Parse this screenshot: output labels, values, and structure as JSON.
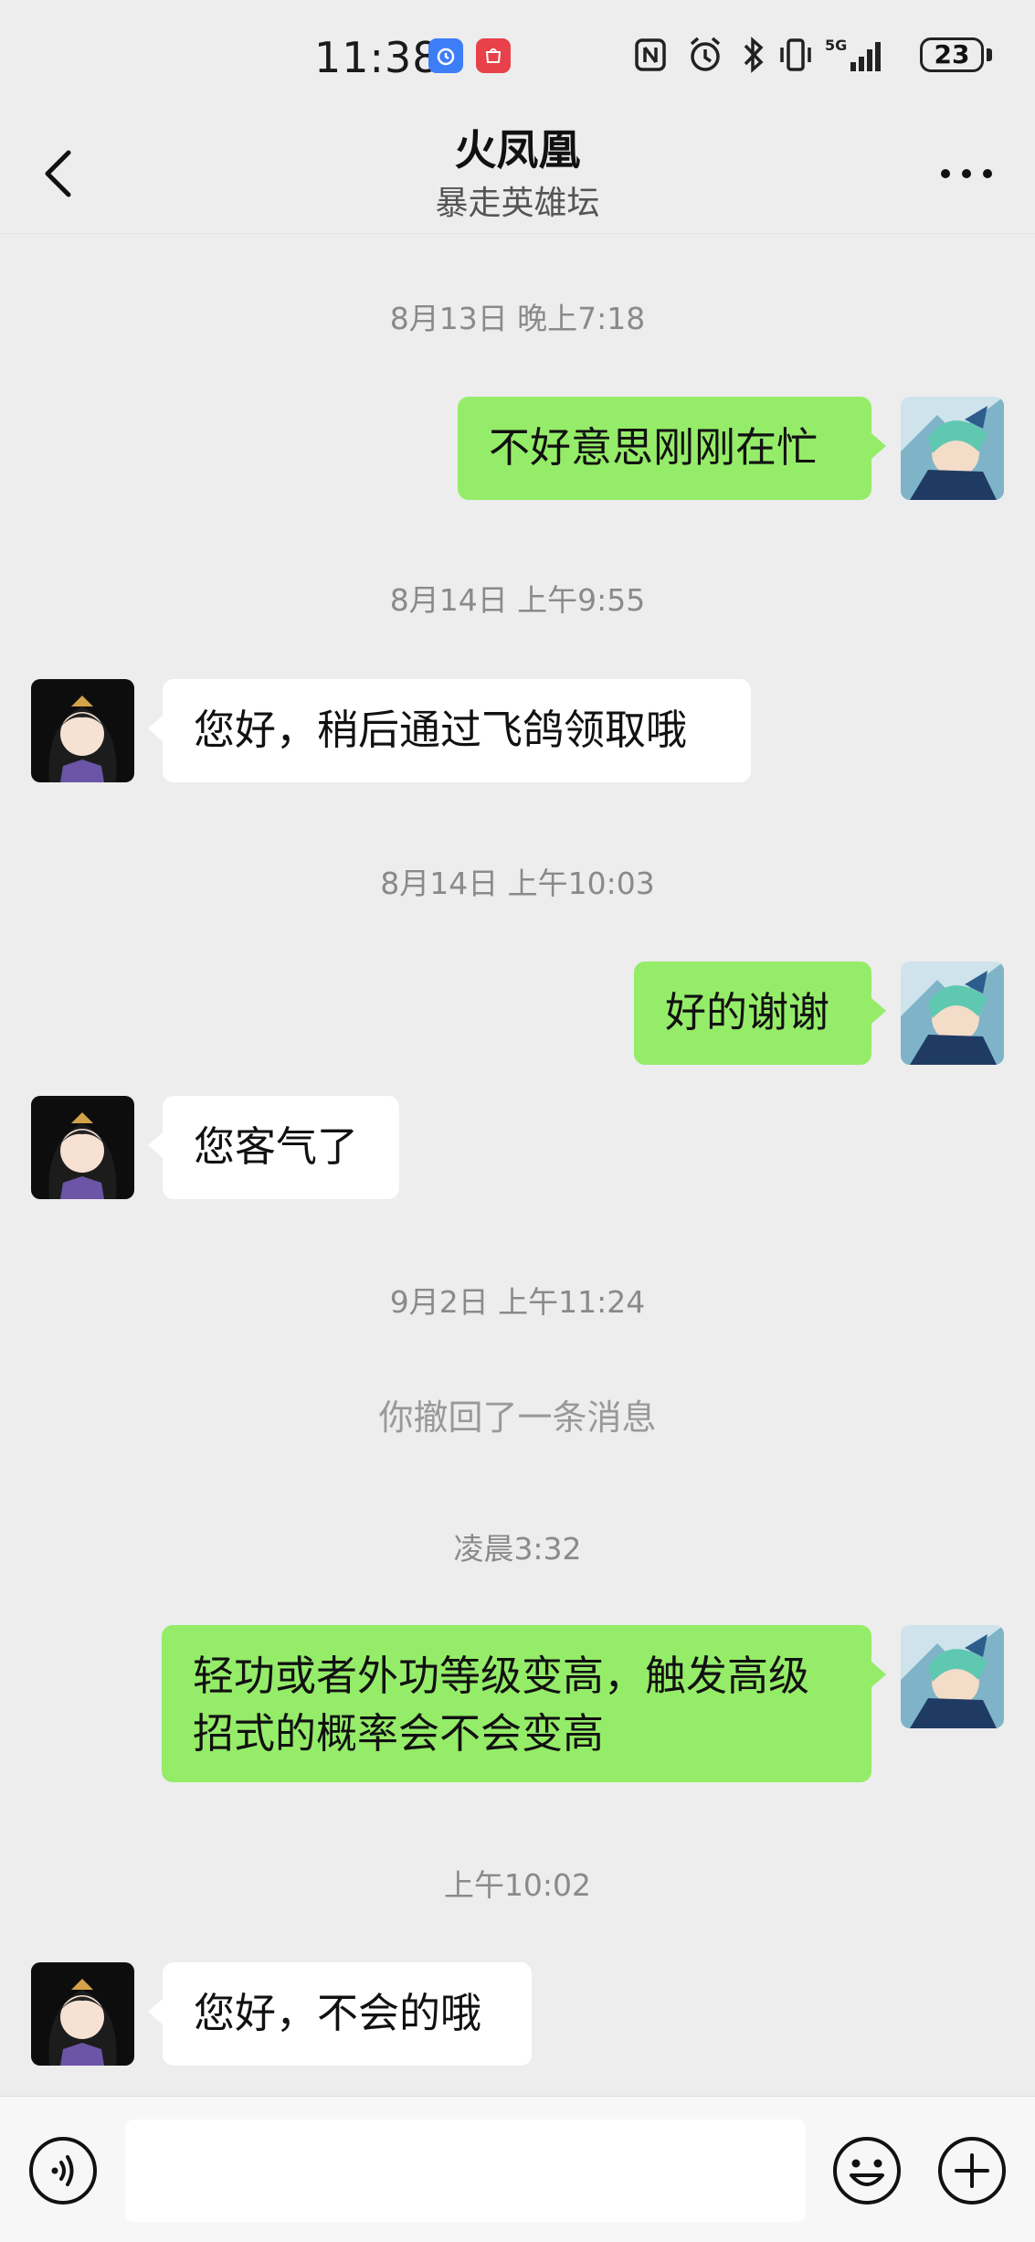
{
  "status": {
    "time": "11:38",
    "battery": "23",
    "network": "5G"
  },
  "header": {
    "title": "火凤凰",
    "subtitle": "暴走英雄坛"
  },
  "timestamps": {
    "t1": "8月13日 晚上7:18",
    "t2": "8月14日 上午9:55",
    "t3": "8月14日 上午10:03",
    "t4": "9月2日 上午11:24",
    "t5": "凌晨3:32",
    "t6": "上午10:02"
  },
  "messages": {
    "m1": "不好意思刚刚在忙",
    "m2": "您好，稍后通过飞鸽领取哦",
    "m3": "好的谢谢",
    "m4": "您客气了",
    "m5_line1": "轻功或者外功等级变高，触发高级",
    "m5_line2": "招式的概率会不会变高",
    "m6": "您好，不会的哦"
  },
  "recall_notice": "你撤回了一条消息",
  "input": {
    "placeholder": ""
  },
  "colors": {
    "background": "#ededed",
    "outgoing_bubble": "#95ec69",
    "incoming_bubble": "#ffffff"
  }
}
